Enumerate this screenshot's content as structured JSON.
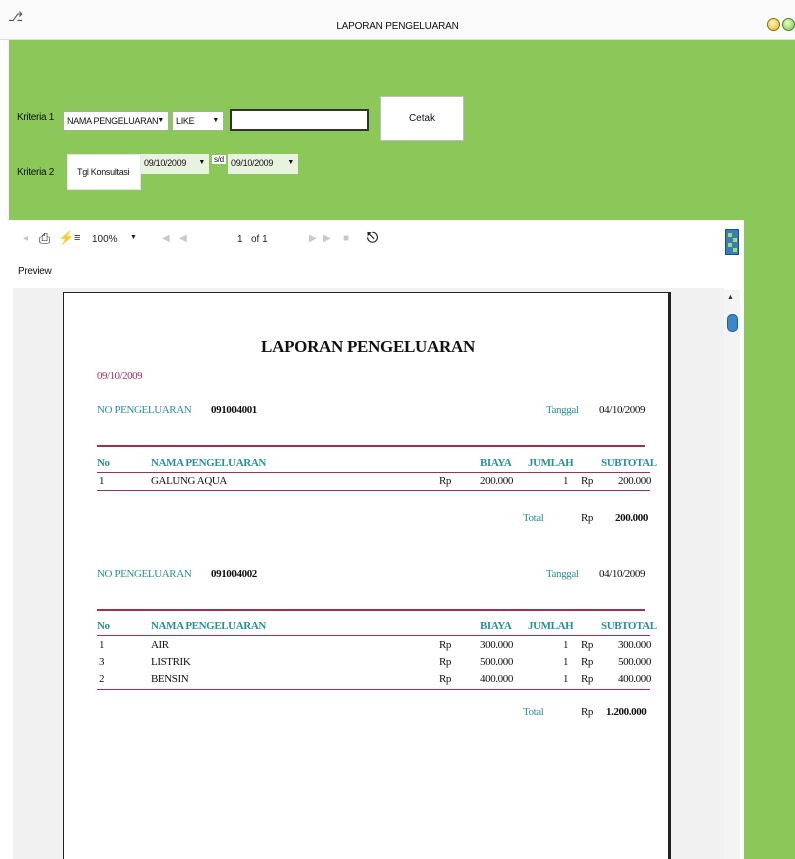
{
  "window": {
    "title": "LAPORAN PENGELUARAN"
  },
  "filter": {
    "kriteria1_label": "Kriteria 1",
    "kriteria1_field": "NAMA PENGELUARAN",
    "kriteria1_operator": "LIKE",
    "kriteria1_value": "",
    "cetak_label": "Cetak",
    "kriteria2_label": "Kriteria 2",
    "kriteria2_field": "Tgl Konsultasi",
    "date_from": "09/10/2009",
    "sd_label": "s/d",
    "date_to": "09/10/2009"
  },
  "viewer": {
    "zoom": "100%",
    "page_current": "1",
    "page_of": "of 1",
    "preview_label": "Preview"
  },
  "report": {
    "title": "LAPORAN PENGELUARAN",
    "print_date": "09/10/2009",
    "no_label": "NO PENGELUARAN",
    "tanggal_label": "Tanggal",
    "columns": {
      "no": "No",
      "nama": "NAMA PENGELUARAN",
      "biaya": "BIAYA",
      "jumlah": "JUMLAH",
      "subtotal": "SUBTOTAL"
    },
    "currency": "Rp",
    "total_label": "Total",
    "groups": [
      {
        "no_pengeluaran": "091004001",
        "tanggal": "04/10/2009",
        "rows": [
          {
            "no": "1",
            "nama": "GALUNG AQUA",
            "biaya": "200.000",
            "jumlah": "1",
            "subtotal": "200.000"
          }
        ],
        "total": "200.000"
      },
      {
        "no_pengeluaran": "091004002",
        "tanggal": "04/10/2009",
        "rows": [
          {
            "no": "1",
            "nama": "AIR",
            "biaya": "300.000",
            "jumlah": "1",
            "subtotal": "300.000"
          },
          {
            "no": "3",
            "nama": "LISTRIK",
            "biaya": "500.000",
            "jumlah": "1",
            "subtotal": "500.000"
          },
          {
            "no": "2",
            "nama": "BENSIN",
            "biaya": "400.000",
            "jumlah": "1",
            "subtotal": "400.000"
          }
        ],
        "total": "1.200.000"
      }
    ]
  },
  "icons": {
    "app": "app-icon",
    "print": "printer-icon",
    "export": "lightning-icon",
    "tree": "group-tree-icon",
    "search": "binoculars-icon",
    "nav": "navigation-arrows-icon"
  },
  "colors": {
    "panel_green": "#8cc75a",
    "accent_teal": "#2a8f9a",
    "rule_maroon": "#a03050"
  }
}
